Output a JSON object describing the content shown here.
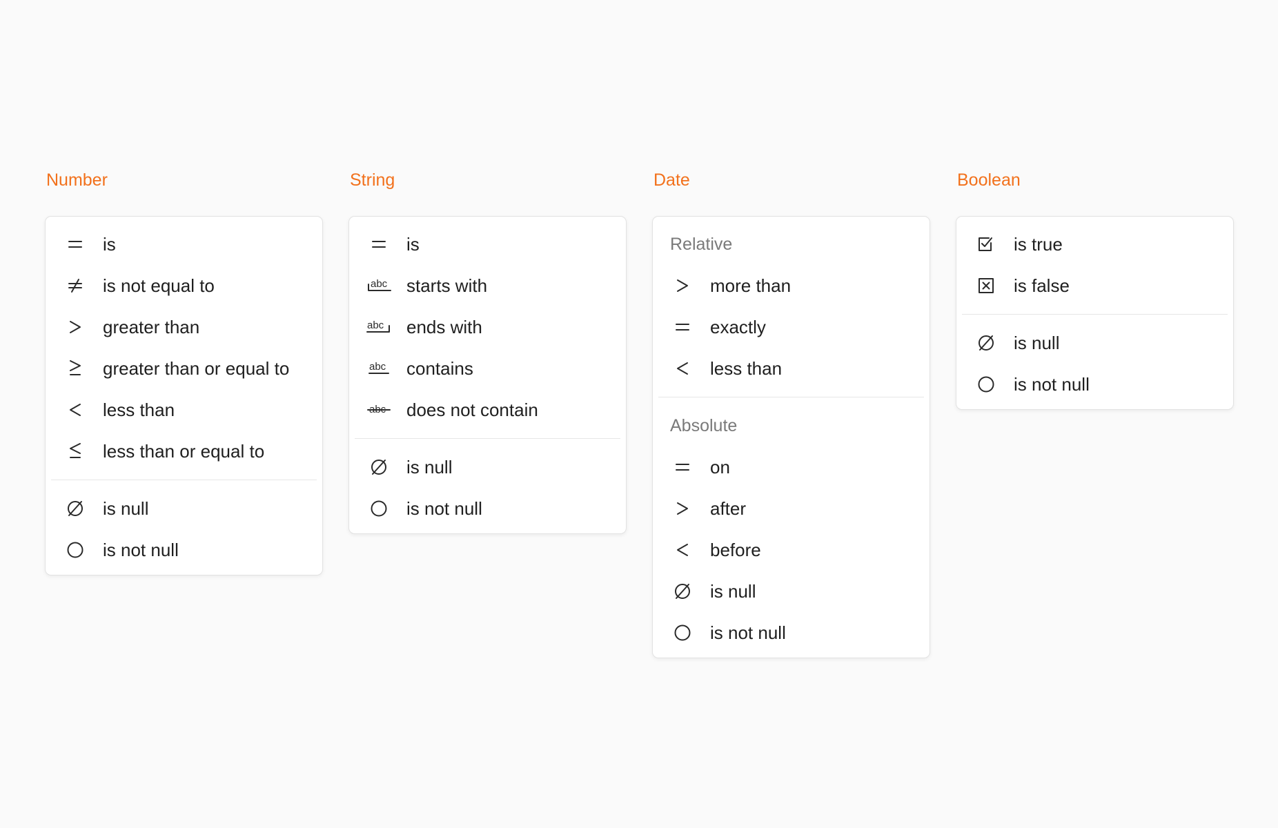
{
  "columns": [
    {
      "title": "Number",
      "groups": [
        {
          "items": [
            {
              "icon": "equals-icon",
              "label": "is"
            },
            {
              "icon": "not-equal-icon",
              "label": "is not equal to"
            },
            {
              "icon": "greater-than-icon",
              "label": "greater than"
            },
            {
              "icon": "greater-or-equal-icon",
              "label": "greater than or equal to"
            },
            {
              "icon": "less-than-icon",
              "label": "less than"
            },
            {
              "icon": "less-or-equal-icon",
              "label": "less than or equal to"
            }
          ]
        },
        {
          "items": [
            {
              "icon": "empty-set-icon",
              "label": "is null"
            },
            {
              "icon": "circle-icon",
              "label": "is not null"
            }
          ]
        }
      ]
    },
    {
      "title": "String",
      "groups": [
        {
          "items": [
            {
              "icon": "equals-icon",
              "label": "is"
            },
            {
              "icon": "starts-with-icon",
              "label": "starts with"
            },
            {
              "icon": "ends-with-icon",
              "label": "ends with"
            },
            {
              "icon": "contains-icon",
              "label": "contains"
            },
            {
              "icon": "does-not-contain-icon",
              "label": "does not contain"
            }
          ]
        },
        {
          "items": [
            {
              "icon": "empty-set-icon",
              "label": "is null"
            },
            {
              "icon": "circle-icon",
              "label": "is not null"
            }
          ]
        }
      ]
    },
    {
      "title": "Date",
      "groups": [
        {
          "label": "Relative",
          "items": [
            {
              "icon": "greater-than-icon",
              "label": "more than"
            },
            {
              "icon": "equals-icon",
              "label": "exactly"
            },
            {
              "icon": "less-than-icon",
              "label": "less than"
            }
          ]
        },
        {
          "label": "Absolute",
          "items": [
            {
              "icon": "equals-icon",
              "label": "on"
            },
            {
              "icon": "greater-than-icon",
              "label": "after"
            },
            {
              "icon": "less-than-icon",
              "label": "before"
            },
            {
              "icon": "empty-set-icon",
              "label": "is null"
            },
            {
              "icon": "circle-icon",
              "label": "is not null"
            }
          ]
        }
      ]
    },
    {
      "title": "Boolean",
      "groups": [
        {
          "items": [
            {
              "icon": "checkbox-checked-icon",
              "label": "is true"
            },
            {
              "icon": "checkbox-x-icon",
              "label": "is false"
            }
          ]
        },
        {
          "items": [
            {
              "icon": "empty-set-icon",
              "label": "is null"
            },
            {
              "icon": "circle-icon",
              "label": "is not null"
            }
          ]
        }
      ]
    }
  ],
  "icon_text": {
    "abc": "abc"
  },
  "colors": {
    "accent": "#f2711c",
    "background": "#fafafa",
    "panel": "#ffffff",
    "group_label": "#7a7a7a"
  }
}
